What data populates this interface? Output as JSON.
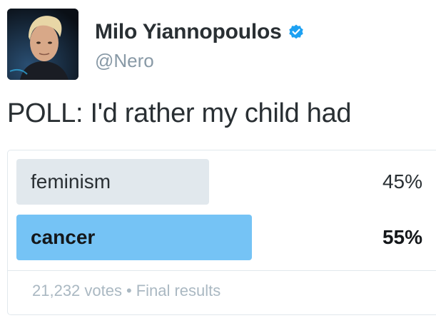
{
  "user": {
    "display_name": "Milo Yiannopoulos",
    "handle": "@Nero",
    "verified": true,
    "avatar_icon": "profile-photo"
  },
  "tweet": {
    "text": "POLL: I'd rather my child had"
  },
  "poll": {
    "choices": [
      {
        "label": "feminism",
        "percent": 45,
        "percent_label": "45%",
        "winner": false,
        "bar_color": "#e1e8ed"
      },
      {
        "label": "cancer",
        "percent": 55,
        "percent_label": "55%",
        "winner": true,
        "bar_color": "#75c3f5"
      }
    ],
    "votes": "21,232 votes",
    "separator": "•",
    "status": "Final results"
  },
  "colors": {
    "verified_blue": "#1da1f2",
    "muted_text": "#8899a6"
  }
}
